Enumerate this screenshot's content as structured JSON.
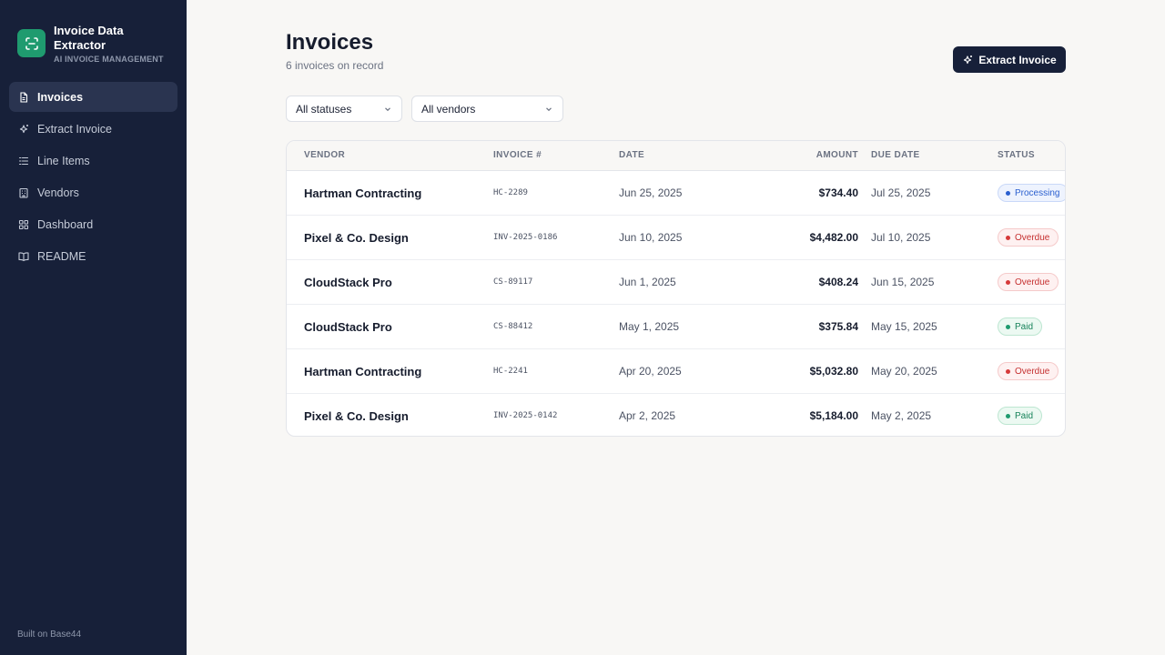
{
  "app": {
    "title": "Invoice Data Extractor",
    "subtitle": "AI INVOICE MANAGEMENT",
    "footer": "Built on Base44"
  },
  "sidebar": {
    "items": [
      {
        "label": "Invoices",
        "icon": "file-icon",
        "active": true
      },
      {
        "label": "Extract Invoice",
        "icon": "sparkles-icon",
        "active": false
      },
      {
        "label": "Line Items",
        "icon": "list-icon",
        "active": false
      },
      {
        "label": "Vendors",
        "icon": "building-icon",
        "active": false
      },
      {
        "label": "Dashboard",
        "icon": "grid-icon",
        "active": false
      },
      {
        "label": "README",
        "icon": "book-icon",
        "active": false
      }
    ]
  },
  "header": {
    "title": "Invoices",
    "subtitle": "6 invoices on record",
    "extract_button": "Extract Invoice"
  },
  "filters": {
    "status": "All statuses",
    "vendor": "All vendors"
  },
  "table": {
    "columns": {
      "vendor": "VENDOR",
      "invoice": "INVOICE #",
      "date": "DATE",
      "amount": "AMOUNT",
      "due": "DUE DATE",
      "status": "STATUS"
    },
    "rows": [
      {
        "vendor": "Hartman Contracting",
        "invoice": "HC-2289",
        "date": "Jun 25, 2025",
        "amount": "$734.40",
        "due": "Jul 25, 2025",
        "status": "Processing",
        "status_type": "processing"
      },
      {
        "vendor": "Pixel & Co. Design",
        "invoice": "INV-2025-0186",
        "date": "Jun 10, 2025",
        "amount": "$4,482.00",
        "due": "Jul 10, 2025",
        "status": "Overdue",
        "status_type": "overdue"
      },
      {
        "vendor": "CloudStack Pro",
        "invoice": "CS-89117",
        "date": "Jun 1, 2025",
        "amount": "$408.24",
        "due": "Jun 15, 2025",
        "status": "Overdue",
        "status_type": "overdue"
      },
      {
        "vendor": "CloudStack Pro",
        "invoice": "CS-88412",
        "date": "May 1, 2025",
        "amount": "$375.84",
        "due": "May 15, 2025",
        "status": "Paid",
        "status_type": "paid"
      },
      {
        "vendor": "Hartman Contracting",
        "invoice": "HC-2241",
        "date": "Apr 20, 2025",
        "amount": "$5,032.80",
        "due": "May 20, 2025",
        "status": "Overdue",
        "status_type": "overdue"
      },
      {
        "vendor": "Pixel & Co. Design",
        "invoice": "INV-2025-0142",
        "date": "Apr 2, 2025",
        "amount": "$5,184.00",
        "due": "May 2, 2025",
        "status": "Paid",
        "status_type": "paid"
      }
    ]
  },
  "colors": {
    "sidebar": "#172039",
    "accent": "#1f9b6f",
    "processing": "#2a5fcf",
    "overdue": "#d63a3a",
    "paid": "#1f9b6f"
  }
}
